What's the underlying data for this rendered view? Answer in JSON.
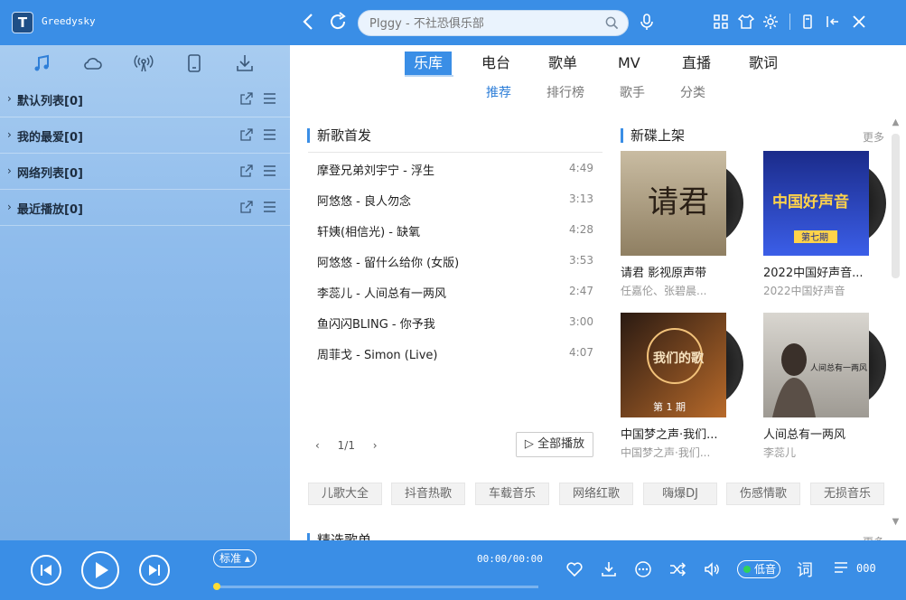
{
  "app": {
    "name": "Greedysky",
    "logo_letter": "T"
  },
  "search": {
    "placeholder": "PIggy - 不社恐俱乐部"
  },
  "sidebar": {
    "items": [
      {
        "label": "默认列表[0]"
      },
      {
        "label": "我的最爱[0]"
      },
      {
        "label": "网络列表[0]"
      },
      {
        "label": "最近播放[0]"
      }
    ]
  },
  "nav": {
    "tabs": [
      "乐库",
      "电台",
      "歌单",
      "MV",
      "直播",
      "歌词"
    ],
    "active": "乐库"
  },
  "subnav": {
    "tabs": [
      "推荐",
      "排行榜",
      "歌手",
      "分类"
    ],
    "active": "推荐"
  },
  "new_songs": {
    "title": "新歌首发",
    "songs": [
      {
        "name": "摩登兄弟刘宇宁 - 浮生",
        "duration": "4:49"
      },
      {
        "name": "阿悠悠 - 良人勿念",
        "duration": "3:13"
      },
      {
        "name": "轩姨(相信光) - 缺氧",
        "duration": "4:28"
      },
      {
        "name": "阿悠悠 - 留什么给你 (女版)",
        "duration": "3:53"
      },
      {
        "name": "李蕊儿 - 人间总有一两风",
        "duration": "2:47"
      },
      {
        "name": "鱼闪闪BLING - 你予我",
        "duration": "3:00"
      },
      {
        "name": "周菲戈 - Simon (Live)",
        "duration": "4:07"
      }
    ],
    "page": "1/1",
    "play_all": "全部播放"
  },
  "new_albums": {
    "title": "新碟上架",
    "more": "更多",
    "albums": [
      {
        "title": "请君 影视原声带",
        "artist": "任嘉伦、张碧晨...",
        "cover_text": "请君"
      },
      {
        "title": "2022中国好声音...",
        "artist": "2022中国好声音",
        "cover_text": "中国好声音",
        "cover_sub": "第七期"
      },
      {
        "title": "中国梦之声·我们...",
        "artist": "中国梦之声·我们...",
        "cover_text": "我们的歌",
        "cover_sub": "第 1 期"
      },
      {
        "title": "人间总有一两风",
        "artist": "李蕊儿",
        "cover_text": "人间总有一两风"
      }
    ]
  },
  "tags": [
    "儿歌大全",
    "抖音热歌",
    "车载音乐",
    "网络红歌",
    "嗨爆DJ",
    "伤感情歌",
    "无损音乐"
  ],
  "playlists_section": {
    "title": "精选歌单",
    "more": "更多"
  },
  "player": {
    "quality": "标准",
    "time": "00:00/00:00",
    "low_quality": "低音",
    "lyric": "词",
    "count": "000",
    "progress": 0
  },
  "colors": {
    "accent": "#3a8ee6",
    "sidebar": "#8fbcec"
  }
}
